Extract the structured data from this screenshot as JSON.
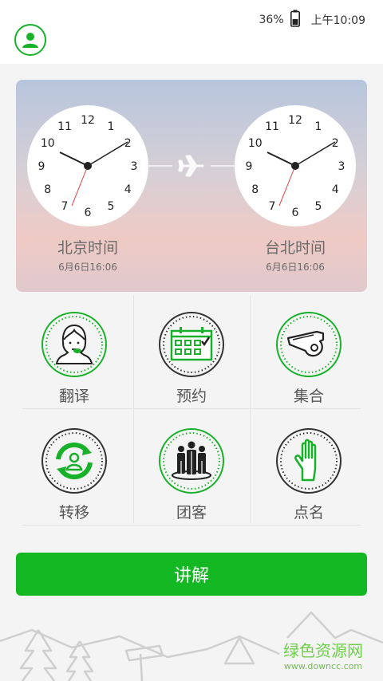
{
  "status_bar": {
    "battery_percent": "36%",
    "time": "上午10:09"
  },
  "clocks": [
    {
      "city": "北京时间",
      "date": "6月6日16:06"
    },
    {
      "city": "台北时间",
      "date": "6月6日16:06"
    }
  ],
  "clock_numbers": [
    "12",
    "1",
    "2",
    "3",
    "4",
    "5",
    "6",
    "7",
    "8",
    "9",
    "10",
    "11"
  ],
  "features": [
    {
      "label": "翻译",
      "icon": "translator-icon"
    },
    {
      "label": "预约",
      "icon": "calendar-icon"
    },
    {
      "label": "集合",
      "icon": "whistle-icon"
    },
    {
      "label": "转移",
      "icon": "transfer-icon"
    },
    {
      "label": "团客",
      "icon": "group-icon"
    },
    {
      "label": "点名",
      "icon": "hand-icon"
    }
  ],
  "primary_button": {
    "label": "讲解"
  },
  "watermark": {
    "main": "绿色资源网",
    "sub": "www.downcc.com"
  },
  "colors": {
    "accent": "#14b823",
    "ring_green": "#19b12a",
    "ring_dark": "#333333"
  }
}
